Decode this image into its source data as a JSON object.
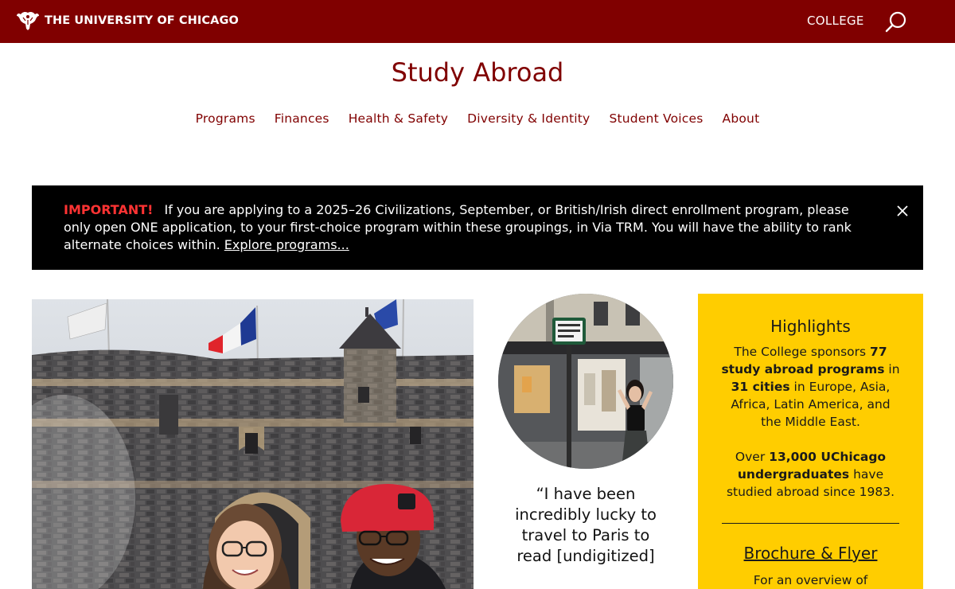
{
  "header": {
    "brand": "THE UNIVERSITY OF CHICAGO",
    "college_link": "COLLEGE",
    "search_icon": "search-icon"
  },
  "site": {
    "title": "Study Abroad"
  },
  "nav": {
    "items": [
      "Programs",
      "Finances",
      "Health & Safety",
      "Diversity & Identity",
      "Student Voices",
      "About"
    ]
  },
  "alert": {
    "label": "IMPORTANT!",
    "text": "If you are applying to a 2025–26 Civilizations, September, or British/Irish direct enrollment program, please only open ONE application, to your first-choice program within these groupings, in Via TRM. You will have the ability to rank alternate choices within.",
    "link": "Explore programs...",
    "close_icon": "close-icon"
  },
  "quote": {
    "text": "“I have been incredibly lucky to travel to Paris to read [undigitized]"
  },
  "highlights": {
    "heading": "Highlights",
    "p1_a": "The College sponsors",
    "p1_b": "77 study abroad programs",
    "p1_c": "in",
    "p1_d": "31 cities",
    "p1_e": "in Europe, Asia, Africa, Latin America, and the Middle East.",
    "p2_a": "Over",
    "p2_b": "13,000 UChicago undergraduates",
    "p2_c": "have studied abroad since 1983.",
    "brochure_link": "Brochure & Flyer",
    "brochure_text": "For an overview of"
  },
  "colors": {
    "maroon": "#800000",
    "gold": "#ffcd00",
    "alert_bg": "#000000",
    "alert_label": "#ff3333"
  }
}
